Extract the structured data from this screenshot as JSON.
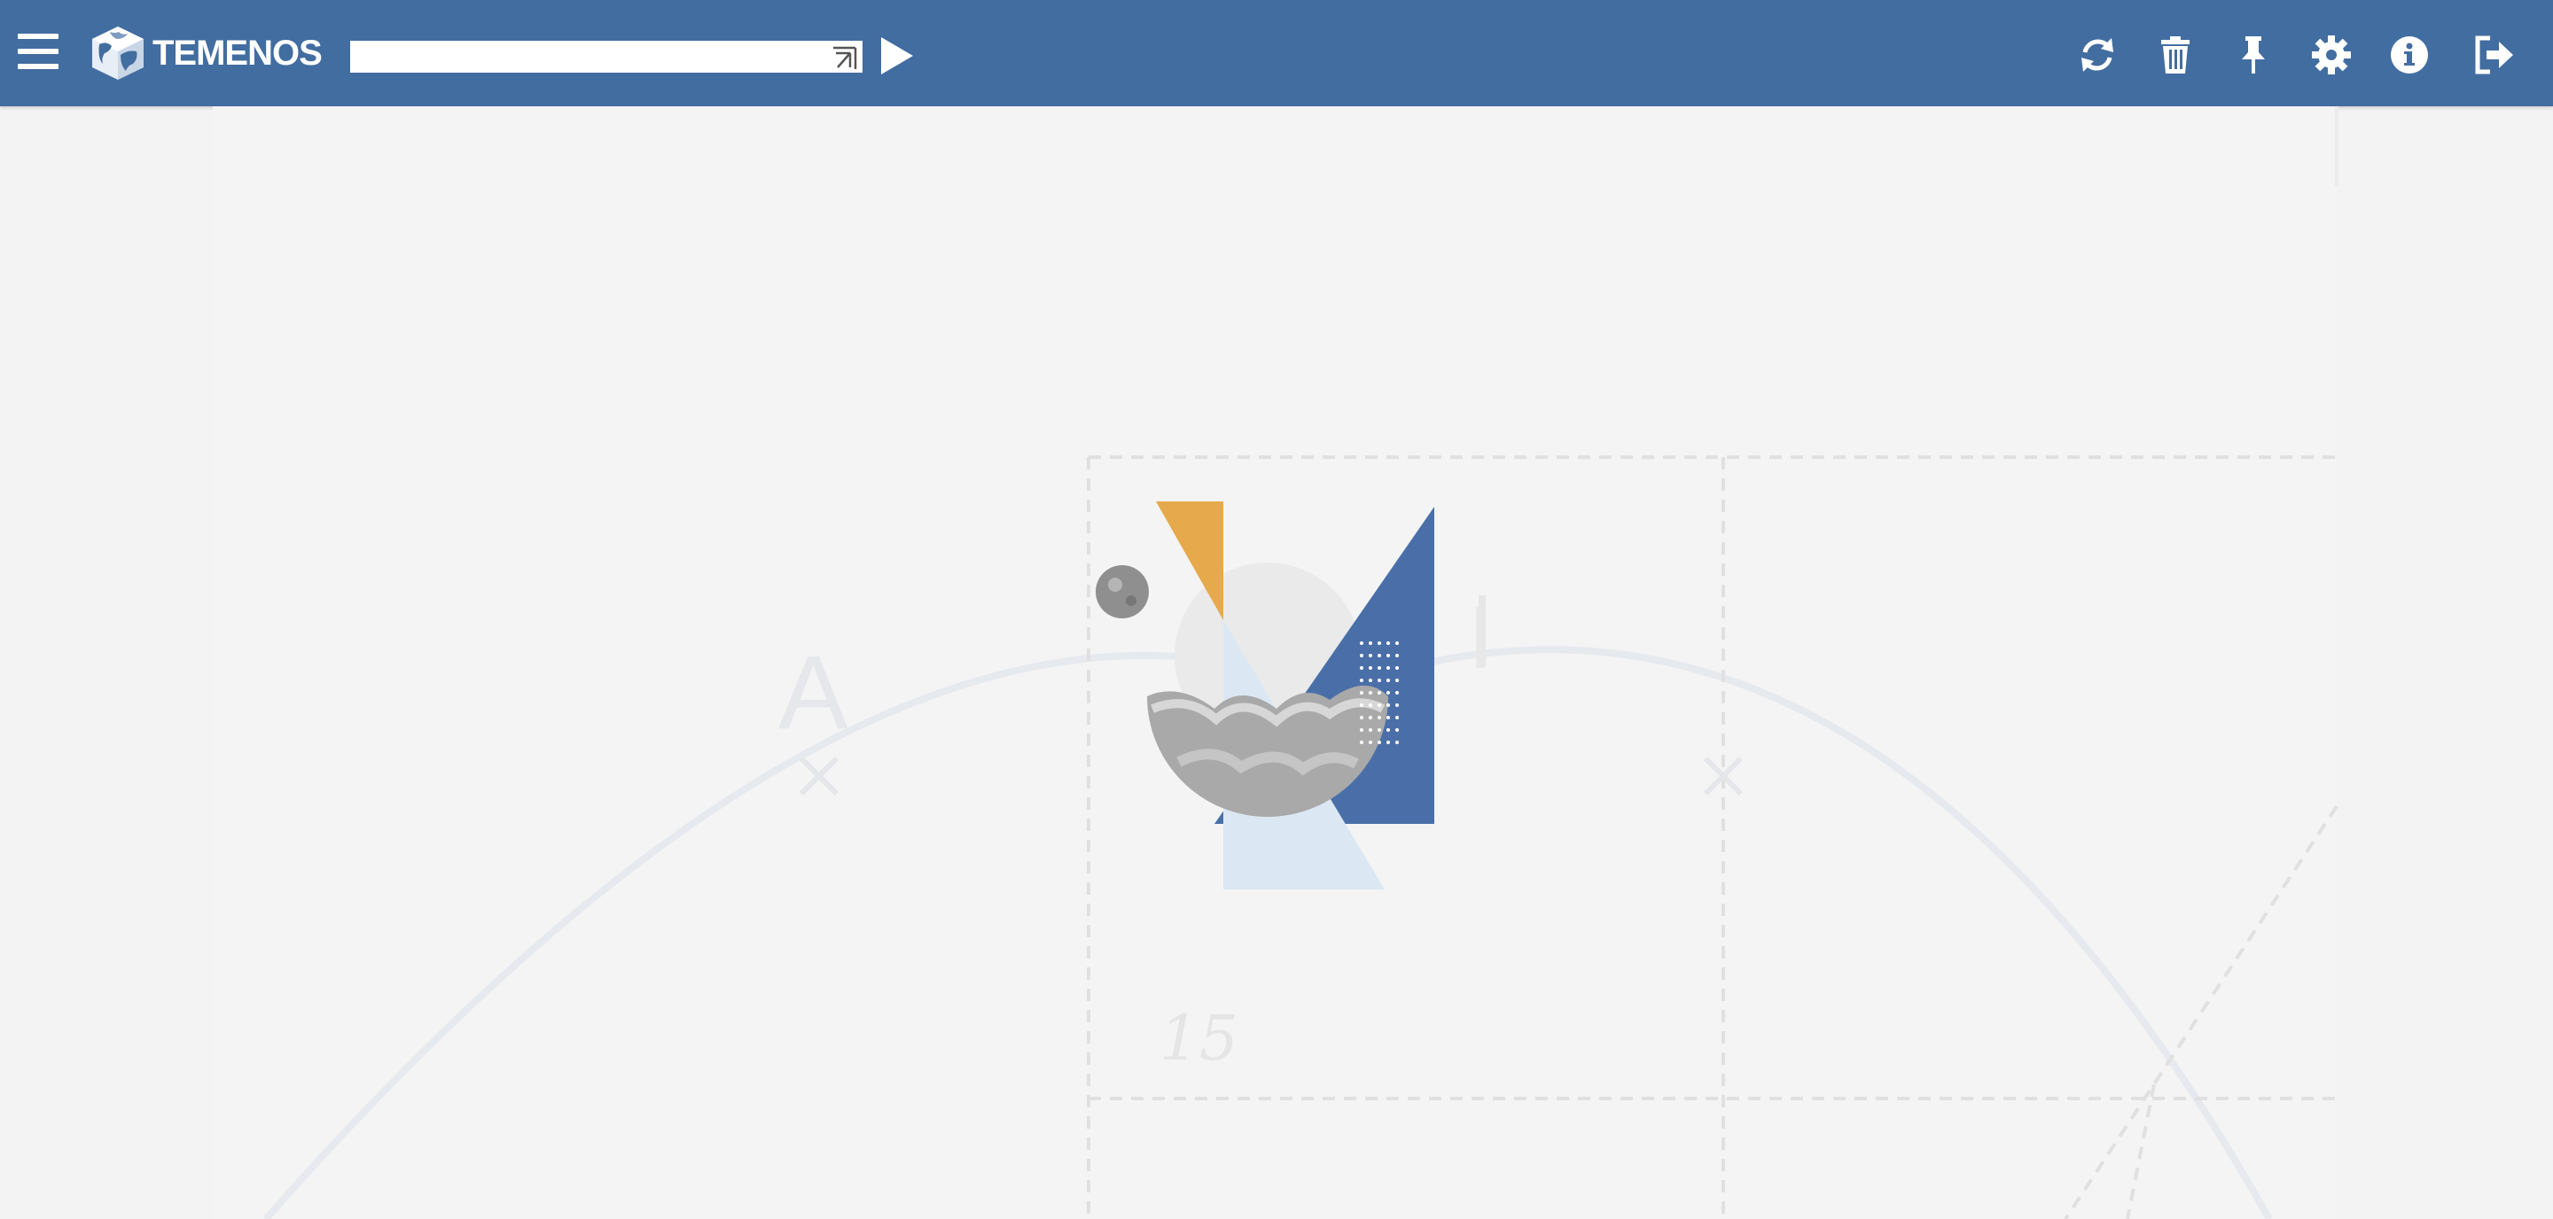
{
  "app": {
    "brand": "TEMENOS",
    "colors": {
      "header": "#426da0",
      "background": "#f3f3f3",
      "accent_blue": "#4a6fa8",
      "accent_orange": "#e6a94c",
      "accent_light_blue": "#dbe8f3"
    }
  },
  "header": {
    "menu_icon": "hamburger-icon",
    "logo_icon": "globe-cube-icon",
    "command": {
      "value": "",
      "placeholder": ""
    },
    "expand_icon": "expand-arrow-icon",
    "go_icon": "play-icon",
    "tools": [
      {
        "name": "refresh-button",
        "icon": "refresh-icon"
      },
      {
        "name": "delete-button",
        "icon": "trash-icon"
      },
      {
        "name": "pin-button",
        "icon": "pin-icon"
      },
      {
        "name": "settings-button",
        "icon": "gear-icon"
      },
      {
        "name": "info-button",
        "icon": "info-icon"
      },
      {
        "name": "logout-button",
        "icon": "logout-icon"
      }
    ]
  },
  "background": {
    "letters": [
      "A",
      "I"
    ],
    "number": "15"
  }
}
